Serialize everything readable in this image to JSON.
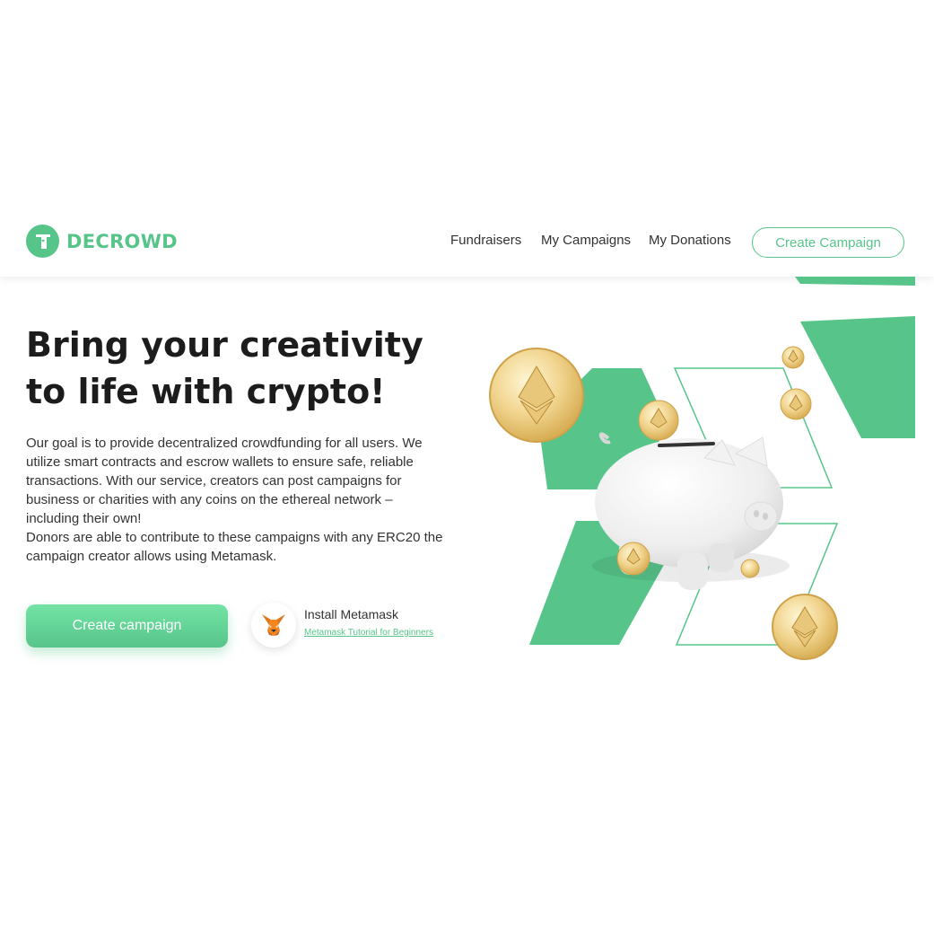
{
  "brand": {
    "name": "DECROWD",
    "color": "#57c58a"
  },
  "nav": {
    "links": [
      "Fundraisers",
      "My Campaigns",
      "My Donations"
    ],
    "cta_label": "Create Campaign"
  },
  "hero": {
    "title": "Bring your creativity to life with crypto!",
    "description_1": "Our goal is to provide decentralized crowdfunding for all users. We utilize smart contracts and escrow wallets to ensure safe, reliable transactions. With our service, creators can post campaigns for business or charities with any coins on the ethereal network – including their own!",
    "description_2": "Donors are able to contribute to these campaigns with any ERC20 the campaign creator allows using Metamask.",
    "cta_label": "Create campaign"
  },
  "metamask": {
    "title": "Install Metamask",
    "link_label": "Metamask Tutorial for Beginners",
    "icon": "metamask-fox-icon"
  },
  "illustration": {
    "subject": "piggy-bank-with-ethereum-coins"
  }
}
